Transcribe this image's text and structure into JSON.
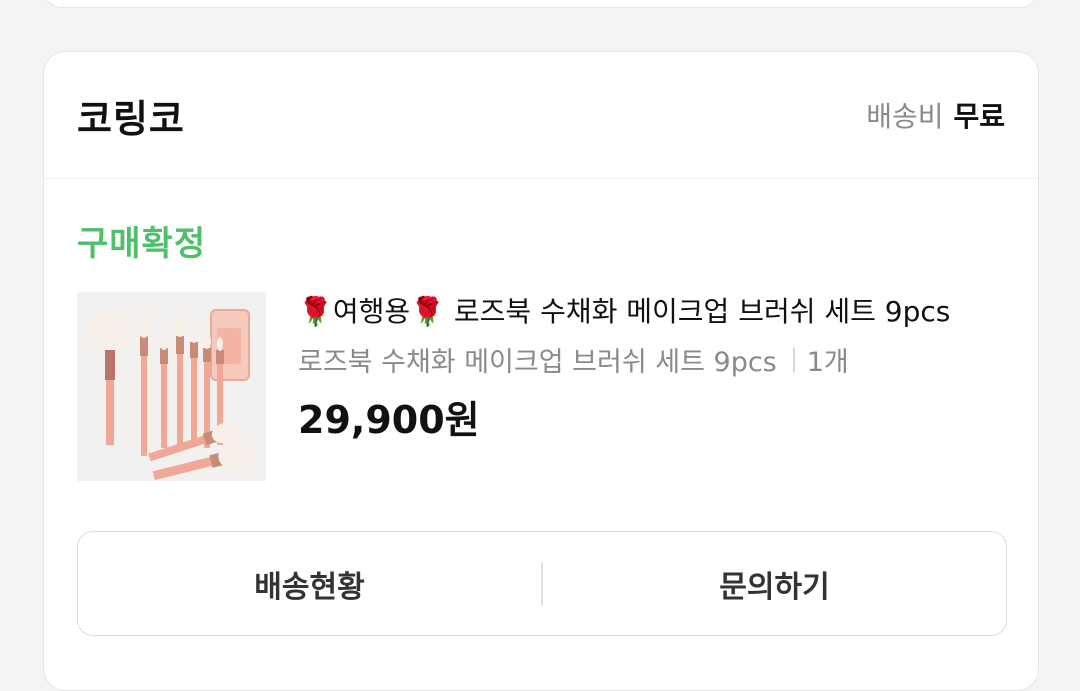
{
  "seller": {
    "name": "코링코",
    "shipping_label": "배송비",
    "shipping_value": "무료"
  },
  "order_status": "구매확정",
  "product": {
    "title": "🌹여행용🌹 로즈북 수채화 메이크업 브러쉬 세트 9pcs",
    "option": "로즈북 수채화 메이크업 브러쉬 세트 9pcs",
    "quantity": "1개",
    "price": "29,900원",
    "image_icon": "makeup-brush-set-image"
  },
  "actions": {
    "tracking_label": "배송현황",
    "inquiry_label": "문의하기"
  },
  "colors": {
    "status_green": "#4fbf6a",
    "brush_pink": "#f0a796",
    "brush_gold": "#c88b75"
  }
}
